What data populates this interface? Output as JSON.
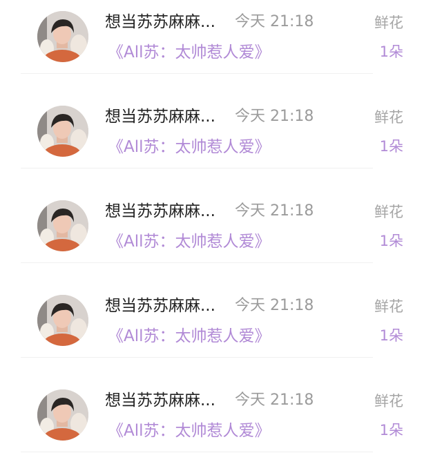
{
  "colors": {
    "username": "#222222",
    "time": "#9b9b9b",
    "gift": "#a5a5a5",
    "accent_purple": "#b18ad6",
    "divider": "#f0f0f0",
    "background": "#ffffff"
  },
  "rows": [
    {
      "avatar_icon": "user-avatar-photo",
      "username": "想当苏苏麻麻...",
      "time": "今天 21:18",
      "gift_label": "鲜花",
      "book_title": "《All苏：太帅惹人爱》",
      "count": "1朵"
    },
    {
      "avatar_icon": "user-avatar-photo",
      "username": "想当苏苏麻麻...",
      "time": "今天 21:18",
      "gift_label": "鲜花",
      "book_title": "《All苏：太帅惹人爱》",
      "count": "1朵"
    },
    {
      "avatar_icon": "user-avatar-photo",
      "username": "想当苏苏麻麻...",
      "time": "今天 21:18",
      "gift_label": "鲜花",
      "book_title": "《All苏：太帅惹人爱》",
      "count": "1朵"
    },
    {
      "avatar_icon": "user-avatar-photo",
      "username": "想当苏苏麻麻...",
      "time": "今天 21:18",
      "gift_label": "鲜花",
      "book_title": "《All苏：太帅惹人爱》",
      "count": "1朵"
    },
    {
      "avatar_icon": "user-avatar-photo",
      "username": "想当苏苏麻麻...",
      "time": "今天 21:18",
      "gift_label": "鲜花",
      "book_title": "《All苏：太帅惹人爱》",
      "count": "1朵"
    }
  ]
}
